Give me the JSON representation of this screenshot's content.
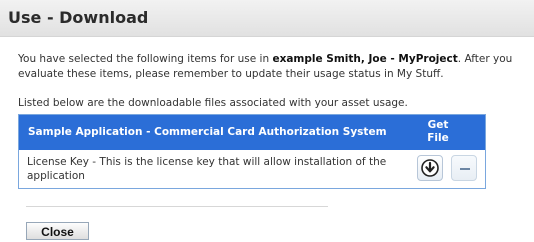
{
  "window": {
    "title": "Use - Download"
  },
  "intro": {
    "line_start": "You have selected the following items for use in ",
    "bold_project": "example Smith, Joe - MyProject",
    "line_end": ". After you evaluate these items, please remember to update their usage status in My Stuff."
  },
  "files_intro": "Listed below are the downloadable files associated with your asset usage.",
  "files_table": {
    "header_name": "Sample Application - Commercial Card Authorization System",
    "header_get_file": "Get File",
    "row_description": "License Key - This is the license key that will allow installation of the application"
  },
  "icons": {
    "download": "download-icon",
    "dash": "dash-icon"
  },
  "buttons": {
    "close": "Close"
  }
}
